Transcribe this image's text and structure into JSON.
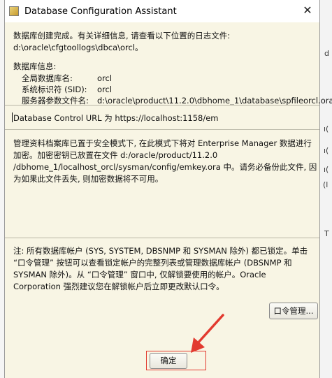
{
  "window": {
    "title": "Database Configuration Assistant",
    "close_glyph": "✕"
  },
  "message": {
    "created_line": "数据库创建完成。有关详细信息, 请查看以下位置的日志文件:",
    "log_path": "d:\\oracle\\cfgtoollogs\\dbca\\orcl。",
    "info_header": "数据库信息:",
    "info": [
      {
        "label": "全局数据库名:",
        "value": "orcl"
      },
      {
        "label": "系统标识符 (SID):",
        "value": "orcl"
      },
      {
        "label": "服务器参数文件名:",
        "value": "d:\\oracle\\product\\11.2.0\\dbhome_1\\database\\spfileorcl.ora"
      }
    ],
    "em_url_line": "Database Control URL 为 https://localhost:1158/em",
    "secure_mode_lines": [
      "管理资料档案库已置于安全模式下, 在此模式下将对 Enterprise Manager 数据进行",
      "加密。加密密钥已放置在文件 d:/oracle/product/11.2.0",
      "/dbhome_1/localhost_orcl/sysman/config/emkey.ora 中。请务必备份此文件, 因",
      "为如果此文件丢失, 则加密数据将不可用。"
    ],
    "note_lines": [
      "注: 所有数据库帐户 (SYS, SYSTEM, DBSNMP 和 SYSMAN 除外) 都已锁定。单击",
      "“口令管理” 按钮可以查看锁定帐户的完整列表或管理数据库帐户 (DBSNMP 和",
      "SYSMAN 除外)。从 “口令管理” 窗口中, 仅解锁要使用的帐户。Oracle",
      "Corporation 强烈建议您在解锁帐户后立即更改默认口令。"
    ]
  },
  "buttons": {
    "password_management": "口令管理...",
    "ok": "确定"
  },
  "background_fragments": [
    {
      "text": "d"
    },
    {
      "text": "ı("
    },
    {
      "text": "ı("
    },
    {
      "text": "ı("
    },
    {
      "text": "(l"
    },
    {
      "text": "T"
    }
  ],
  "colors": {
    "dialog_background": "#f8f5e4",
    "highlight_red": "#e23a2f"
  }
}
